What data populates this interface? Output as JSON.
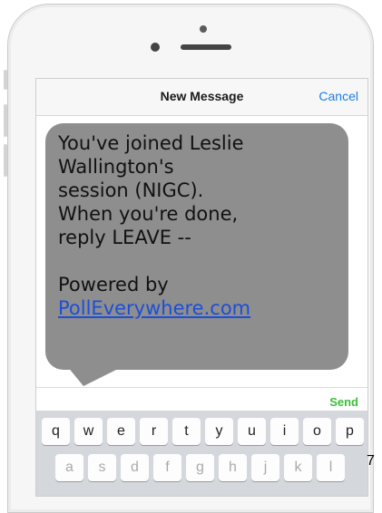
{
  "header": {
    "title": "New Message",
    "cancel_label": "Cancel"
  },
  "message": {
    "lines": [
      "You've joined Leslie",
      "Wallington's",
      "session (NIGC).",
      "When you're done,",
      "reply LEAVE --"
    ],
    "powered_by": "Powered by",
    "link": "PollEverywhere.com"
  },
  "compose": {
    "send_label": "Send"
  },
  "keyboard": {
    "row1": [
      "q",
      "w",
      "e",
      "r",
      "t",
      "y",
      "u",
      "i",
      "o",
      "p"
    ],
    "row2": [
      "a",
      "s",
      "d",
      "f",
      "g",
      "h",
      "j",
      "k",
      "l"
    ]
  },
  "page_number": "7",
  "colors": {
    "bubble": "#8e8e8e",
    "cancel": "#1a7ee8",
    "send": "#3bbf3b",
    "link": "#1c4fd8"
  }
}
